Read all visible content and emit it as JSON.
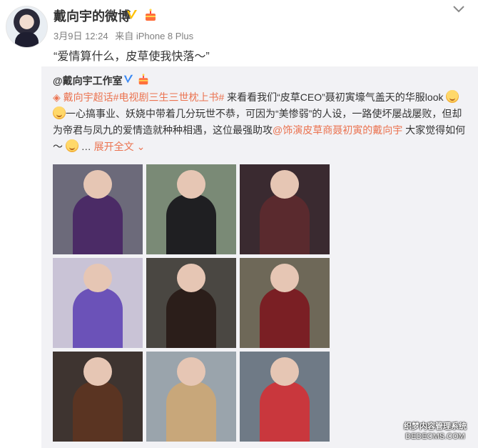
{
  "post": {
    "author": "戴向宇的微博",
    "date": "3月9日 12:24",
    "source": "来自 iPhone 8 Plus",
    "text": "“爱情算什么，皮草使我快落～”"
  },
  "repost": {
    "author": "@戴向宇工作室",
    "topic1": "戴向宇超话",
    "topic2": "#电视剧三生三世枕上书#",
    "text1": " 来看看我们“皮草CEO”聂初寅壕气盖天的华服look",
    "text2": "一心搞事业、妖娆中带着几分玩世不恭，可因为“美惨弱”的人设，一路使坏屡战屡败，但却为帝君与凤九的爱情造就种种相遇，这位最强助攻",
    "mention": "@饰演皮草商聂初寅的戴向宇",
    "text3": " 大家觉得如何～",
    "expand": "展开全文"
  },
  "photos": [
    {
      "bg": "#6c6a7a",
      "robe": "#4b2b66"
    },
    {
      "bg": "#7a8a76",
      "robe": "#1f1f22"
    },
    {
      "bg": "#3a2a30",
      "robe": "#5a2a2e"
    },
    {
      "bg": "#c9c3d6",
      "robe": "#6b52b8"
    },
    {
      "bg": "#4a4742",
      "robe": "#2b1e1a"
    },
    {
      "bg": "#6e6858",
      "robe": "#7a1f24"
    },
    {
      "bg": "#3e3430",
      "robe": "#5a3422"
    },
    {
      "bg": "#9aa4ac",
      "robe": "#c8a77a"
    },
    {
      "bg": "#6f7a86",
      "robe": "#c9373d"
    }
  ],
  "watermark": {
    "line1": "织梦内容管理系统",
    "line2": "DEDECMS.COM"
  },
  "colors": {
    "link": "#eb7350",
    "repost_bg": "#f2f2f5",
    "meta": "#808080"
  },
  "icons": [
    "avatar",
    "verified-v-icon",
    "birthday-icon",
    "chevron-down-icon",
    "gem-icon",
    "emoji-icon"
  ]
}
